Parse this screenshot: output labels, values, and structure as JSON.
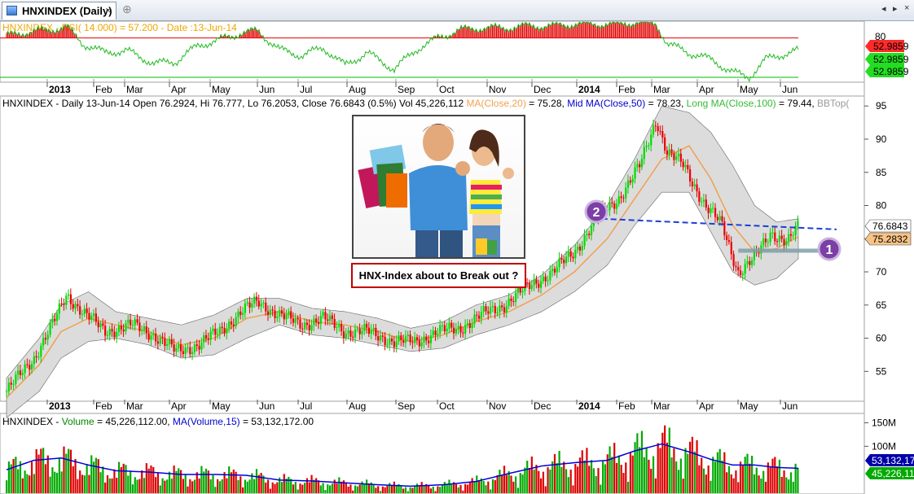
{
  "window": {
    "tab_title": "HNXINDEX (Daily)",
    "close_glyph": "×",
    "new_tab_glyph": "⊕",
    "nav_left_glyph": "◂",
    "nav_right_glyph": "▸",
    "nav_close_glyph": "×"
  },
  "rsi_panel": {
    "label_name": "HNXINDEX - ",
    "label_rest": "RSI( 14.000) = 57.200 - Date :13-Jun-14",
    "price_labels": [
      {
        "text": "52.9859",
        "color": "#ff2a2a"
      },
      {
        "text": "52.9859",
        "color": "#22dd22"
      },
      {
        "text": "52.9859",
        "color": "#22dd22"
      }
    ],
    "axis_tick": "80"
  },
  "price_panel": {
    "header": [
      {
        "text": "HNXINDEX - Daily 13-Jun-14 Open 76.2924, Hi 76.777, Lo 76.2053, Close 76.6843 (0.5%) Vol 45,226,112 ",
        "color": "#000000"
      },
      {
        "text": "MA(Close,20)",
        "color": "#f0a050"
      },
      {
        "text": " = 75.28, ",
        "color": "#000000"
      },
      {
        "text": "Mid MA(Close,50)",
        "color": "#0000cc"
      },
      {
        "text": " = 78.23, ",
        "color": "#000000"
      },
      {
        "text": "Long MA(Close,100)",
        "color": "#33bb33"
      },
      {
        "text": " = 79.44, ",
        "color": "#000000"
      },
      {
        "text": "BBTop(",
        "color": "#999999"
      }
    ],
    "price_labels": [
      {
        "text": "76.6843",
        "bg": "#ffffff",
        "fg": "#000000"
      },
      {
        "text": "75.2832",
        "bg": "#f7c486",
        "fg": "#000000"
      }
    ],
    "markers": [
      "2",
      "1"
    ],
    "callout_text": "HNX-Index about to Break out ?"
  },
  "volume_panel": {
    "header": [
      {
        "text": "HNXINDEX - ",
        "color": "#000000"
      },
      {
        "text": "Volume",
        "color": "#008800"
      },
      {
        "text": " = 45,226,112.00, ",
        "color": "#000000"
      },
      {
        "text": "MA(Volume,15)",
        "color": "#0000cc"
      },
      {
        "text": " = 53,132,172.00",
        "color": "#000000"
      }
    ],
    "price_labels": [
      {
        "text": "53,132,17",
        "bg": "#0000aa",
        "fg": "#ffffff"
      },
      {
        "text": "45,226,11",
        "bg": "#00aa00",
        "fg": "#ffffff"
      }
    ]
  },
  "chart_data": {
    "type": "line",
    "months": [
      "2013",
      "Feb",
      "Mar",
      "Apr",
      "May",
      "Jun",
      "Jul",
      "Aug",
      "Sep",
      "Oct",
      "Nov",
      "Dec",
      "2014",
      "Feb",
      "Mar",
      "Apr",
      "May",
      "Jun"
    ],
    "price_axis": {
      "ticks": [
        55,
        60,
        65,
        70,
        75,
        80,
        85,
        90,
        95
      ],
      "ylim": [
        50.5,
        96.5
      ]
    },
    "rsi_axis": {
      "ticks": [
        80
      ],
      "ylim": [
        25,
        87
      ]
    },
    "volume_axis": {
      "ticks": [
        "150M",
        "100M"
      ],
      "tick_values": [
        150,
        100
      ],
      "ylim": [
        0,
        170
      ]
    },
    "close_series": [
      [
        2013.0,
        52.0
      ],
      [
        2013.05,
        57.0
      ],
      [
        2013.09,
        63.0
      ],
      [
        2013.11,
        66.5
      ],
      [
        2013.14,
        64.0
      ],
      [
        2013.18,
        61.0
      ],
      [
        2013.23,
        62.0
      ],
      [
        2013.27,
        60.5
      ],
      [
        2013.31,
        58.0
      ],
      [
        2013.35,
        59.0
      ],
      [
        2013.39,
        61.0
      ],
      [
        2013.43,
        64.0
      ],
      [
        2013.46,
        65.5
      ],
      [
        2013.5,
        63.5
      ],
      [
        2013.54,
        62.0
      ],
      [
        2013.58,
        63.0
      ],
      [
        2013.62,
        61.0
      ],
      [
        2013.66,
        61.0
      ],
      [
        2013.71,
        59.5
      ],
      [
        2013.75,
        59.5
      ],
      [
        2013.79,
        61.0
      ],
      [
        2013.83,
        61.5
      ],
      [
        2013.87,
        63.5
      ],
      [
        2013.91,
        65.0
      ],
      [
        2013.96,
        68.0
      ],
      [
        2014.0,
        70.0
      ],
      [
        2014.04,
        73.0
      ],
      [
        2014.08,
        78.0
      ],
      [
        2014.12,
        81.0
      ],
      [
        2014.16,
        86.0
      ],
      [
        2014.19,
        93.0
      ],
      [
        2014.21,
        88.0
      ],
      [
        2014.24,
        86.0
      ],
      [
        2014.28,
        80.0
      ],
      [
        2014.31,
        77.0
      ],
      [
        2014.34,
        70.0
      ],
      [
        2014.37,
        72.0
      ],
      [
        2014.4,
        76.0
      ],
      [
        2014.43,
        74.5
      ],
      [
        2014.45,
        76.7
      ]
    ],
    "ma20_series": [
      [
        2013.0,
        51.0
      ],
      [
        2013.06,
        56.0
      ],
      [
        2013.1,
        61.0
      ],
      [
        2013.15,
        63.0
      ],
      [
        2013.2,
        62.0
      ],
      [
        2013.26,
        61.0
      ],
      [
        2013.32,
        59.0
      ],
      [
        2013.38,
        60.0
      ],
      [
        2013.44,
        63.0
      ],
      [
        2013.5,
        64.0
      ],
      [
        2013.56,
        62.5
      ],
      [
        2013.62,
        62.0
      ],
      [
        2013.68,
        61.0
      ],
      [
        2013.74,
        59.5
      ],
      [
        2013.8,
        60.5
      ],
      [
        2013.86,
        62.5
      ],
      [
        2013.92,
        64.0
      ],
      [
        2013.98,
        66.5
      ],
      [
        2014.04,
        70.0
      ],
      [
        2014.1,
        75.0
      ],
      [
        2014.15,
        81.0
      ],
      [
        2014.2,
        87.0
      ],
      [
        2014.25,
        89.0
      ],
      [
        2014.29,
        84.0
      ],
      [
        2014.33,
        77.0
      ],
      [
        2014.37,
        73.0
      ],
      [
        2014.41,
        73.5
      ],
      [
        2014.45,
        75.3
      ]
    ],
    "bb_top_series": [
      [
        2013.0,
        54.0
      ],
      [
        2013.06,
        60.0
      ],
      [
        2013.1,
        65.0
      ],
      [
        2013.15,
        67.0
      ],
      [
        2013.2,
        64.0
      ],
      [
        2013.26,
        63.0
      ],
      [
        2013.32,
        62.0
      ],
      [
        2013.38,
        63.5
      ],
      [
        2013.44,
        66.0
      ],
      [
        2013.5,
        66.0
      ],
      [
        2013.56,
        64.5
      ],
      [
        2013.62,
        64.0
      ],
      [
        2013.68,
        63.0
      ],
      [
        2013.74,
        61.5
      ],
      [
        2013.8,
        62.5
      ],
      [
        2013.86,
        65.0
      ],
      [
        2013.92,
        66.5
      ],
      [
        2013.98,
        69.5
      ],
      [
        2014.04,
        74.0
      ],
      [
        2014.1,
        80.0
      ],
      [
        2014.15,
        87.0
      ],
      [
        2014.2,
        95.0
      ],
      [
        2014.25,
        94.0
      ],
      [
        2014.29,
        91.0
      ],
      [
        2014.33,
        86.0
      ],
      [
        2014.37,
        80.0
      ],
      [
        2014.41,
        77.5
      ],
      [
        2014.45,
        78.0
      ]
    ],
    "bb_bottom_series": [
      [
        2013.0,
        48.0
      ],
      [
        2013.06,
        52.0
      ],
      [
        2013.1,
        57.0
      ],
      [
        2013.15,
        59.5
      ],
      [
        2013.2,
        60.0
      ],
      [
        2013.26,
        59.0
      ],
      [
        2013.32,
        57.0
      ],
      [
        2013.38,
        57.5
      ],
      [
        2013.44,
        60.0
      ],
      [
        2013.5,
        62.0
      ],
      [
        2013.56,
        60.5
      ],
      [
        2013.62,
        60.0
      ],
      [
        2013.68,
        59.0
      ],
      [
        2013.74,
        58.0
      ],
      [
        2013.8,
        58.5
      ],
      [
        2013.86,
        60.5
      ],
      [
        2013.92,
        62.0
      ],
      [
        2013.98,
        64.0
      ],
      [
        2014.04,
        67.0
      ],
      [
        2014.1,
        71.0
      ],
      [
        2014.15,
        77.0
      ],
      [
        2014.2,
        82.0
      ],
      [
        2014.25,
        82.0
      ],
      [
        2014.29,
        76.0
      ],
      [
        2014.33,
        70.0
      ],
      [
        2014.37,
        68.0
      ],
      [
        2014.41,
        69.0
      ],
      [
        2014.45,
        72.0
      ]
    ],
    "rsi_series": [
      [
        2013.0,
        72.0
      ],
      [
        2013.04,
        76.0
      ],
      [
        2013.08,
        78.0
      ],
      [
        2013.11,
        81.0
      ],
      [
        2013.14,
        64.0
      ],
      [
        2013.18,
        55.0
      ],
      [
        2013.22,
        57.0
      ],
      [
        2013.27,
        44.0
      ],
      [
        2013.31,
        46.0
      ],
      [
        2013.35,
        62.0
      ],
      [
        2013.39,
        68.0
      ],
      [
        2013.43,
        75.0
      ],
      [
        2013.46,
        77.0
      ],
      [
        2013.5,
        58.0
      ],
      [
        2013.54,
        52.0
      ],
      [
        2013.58,
        60.0
      ],
      [
        2013.62,
        42.0
      ],
      [
        2013.66,
        55.0
      ],
      [
        2013.71,
        38.0
      ],
      [
        2013.75,
        58.0
      ],
      [
        2013.79,
        70.0
      ],
      [
        2013.83,
        78.0
      ],
      [
        2013.87,
        80.0
      ],
      [
        2013.91,
        80.0
      ],
      [
        2013.96,
        82.0
      ],
      [
        2014.0,
        82.0
      ],
      [
        2014.04,
        84.0
      ],
      [
        2014.08,
        84.0
      ],
      [
        2014.12,
        84.0
      ],
      [
        2014.16,
        86.0
      ],
      [
        2014.19,
        84.0
      ],
      [
        2014.21,
        64.0
      ],
      [
        2014.25,
        55.0
      ],
      [
        2014.29,
        48.0
      ],
      [
        2014.33,
        35.0
      ],
      [
        2014.36,
        30.0
      ],
      [
        2014.39,
        48.0
      ],
      [
        2014.42,
        53.0
      ],
      [
        2014.45,
        57.2
      ]
    ],
    "rsi_overbought": 70,
    "rsi_oversold": 30,
    "volume_ma_series": [
      [
        2013.0,
        50
      ],
      [
        2013.05,
        70
      ],
      [
        2013.1,
        75
      ],
      [
        2013.15,
        60
      ],
      [
        2013.2,
        48
      ],
      [
        2013.26,
        45
      ],
      [
        2013.32,
        40
      ],
      [
        2013.38,
        40
      ],
      [
        2013.44,
        38
      ],
      [
        2013.5,
        28
      ],
      [
        2013.56,
        26
      ],
      [
        2013.62,
        22
      ],
      [
        2013.68,
        18
      ],
      [
        2013.74,
        15
      ],
      [
        2013.8,
        18
      ],
      [
        2013.86,
        25
      ],
      [
        2013.92,
        42
      ],
      [
        2013.98,
        58
      ],
      [
        2014.04,
        65
      ],
      [
        2014.1,
        70
      ],
      [
        2014.15,
        90
      ],
      [
        2014.2,
        105
      ],
      [
        2014.25,
        88
      ],
      [
        2014.29,
        72
      ],
      [
        2014.33,
        60
      ],
      [
        2014.37,
        60
      ],
      [
        2014.41,
        55
      ],
      [
        2014.45,
        53
      ]
    ],
    "volume_last": 45.2,
    "resistance_line": [
      [
        2014.09,
        78.0
      ],
      [
        2014.52,
        76.4
      ]
    ],
    "support_line": [
      [
        2014.34,
        73.2
      ],
      [
        2014.5,
        73.2
      ]
    ]
  }
}
